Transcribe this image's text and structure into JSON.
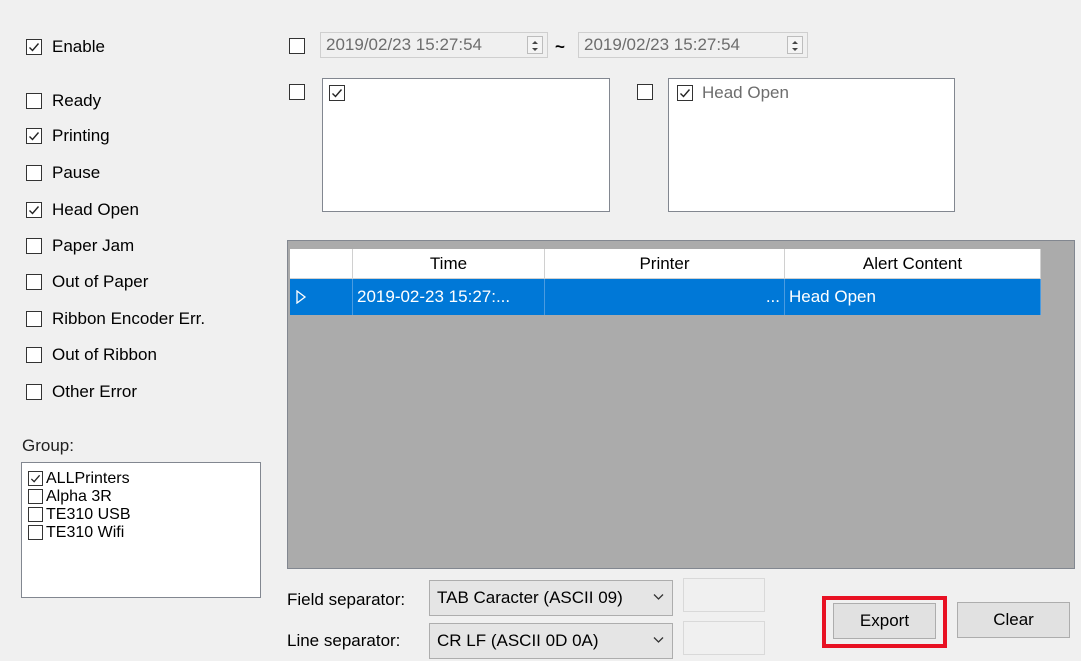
{
  "filters": {
    "enable": {
      "label": "Enable",
      "checked": true
    },
    "statuses": [
      {
        "label": "Ready",
        "checked": false
      },
      {
        "label": "Printing",
        "checked": true
      },
      {
        "label": "Pause",
        "checked": false
      },
      {
        "label": "Head Open",
        "checked": true
      },
      {
        "label": "Paper Jam",
        "checked": false
      },
      {
        "label": "Out of Paper",
        "checked": false
      },
      {
        "label": "Ribbon Encoder Err.",
        "checked": false
      },
      {
        "label": "Out of Ribbon",
        "checked": false
      },
      {
        "label": "Other Error",
        "checked": false
      }
    ],
    "group_label": "Group:",
    "groups": [
      {
        "label": "ALLPrinters",
        "checked": true
      },
      {
        "label": "Alpha 3R",
        "checked": false
      },
      {
        "label": "TE310 USB",
        "checked": false
      },
      {
        "label": "TE310 Wifi",
        "checked": false
      }
    ]
  },
  "date_range": {
    "checked": false,
    "from": "2019/02/23 15:27:54",
    "separator": "~",
    "to": "2019/02/23 15:27:54"
  },
  "printer_filter": {
    "checked": false,
    "items": [
      {
        "label": "",
        "checked": true
      }
    ]
  },
  "alert_filter": {
    "checked": false,
    "items": [
      {
        "label": "Head Open",
        "checked": true
      }
    ]
  },
  "grid": {
    "columns": [
      "Time",
      "Printer",
      "Alert Content"
    ],
    "rows": [
      {
        "time": "2019-02-23 15:27:...",
        "printer": "...",
        "alert": "Head Open",
        "selected": true
      }
    ]
  },
  "export_options": {
    "field_separator_label": "Field separator:",
    "field_separator_value": "TAB Caracter (ASCII 09)",
    "line_separator_label": "Line separator:",
    "line_separator_value": "CR LF (ASCII 0D 0A)"
  },
  "buttons": {
    "export": "Export",
    "clear": "Clear"
  },
  "colors": {
    "selection": "#0078d7",
    "highlight": "#e81123"
  }
}
